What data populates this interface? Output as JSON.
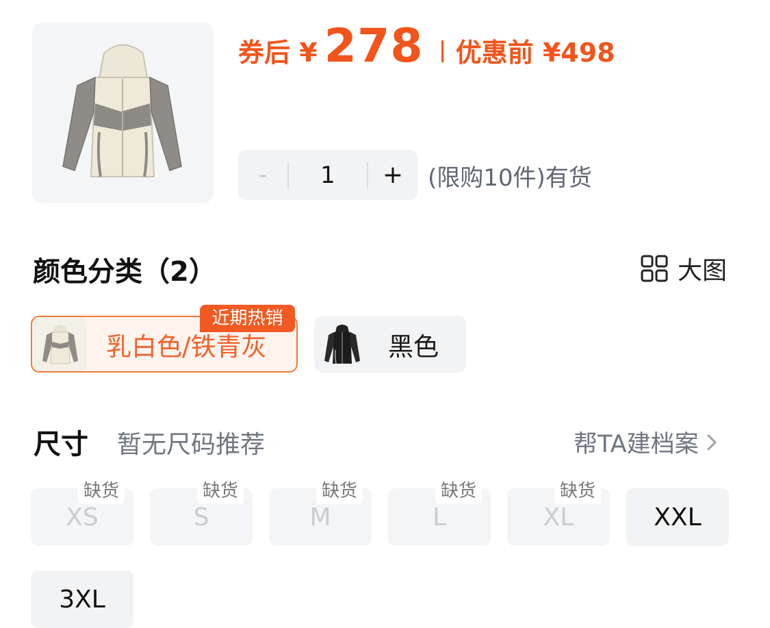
{
  "price": {
    "prefix": "券后 ¥",
    "value": "278",
    "original": "优惠前 ¥498"
  },
  "quantity": {
    "minus": "-",
    "value": "1",
    "plus": "+",
    "stock_note": "(限购10件)有货"
  },
  "color_section": {
    "title": "颜色分类（2）",
    "big_image_label": "大图",
    "hot_badge": "近期热销",
    "options": [
      {
        "label": "乳白色/铁青灰"
      },
      {
        "label": "黑色"
      }
    ]
  },
  "size_section": {
    "title": "尺寸",
    "tip": "暂无尺码推荐",
    "profile_link": "帮TA建档案",
    "out_of_stock_label": "缺货",
    "sizes": [
      {
        "label": "XS"
      },
      {
        "label": "S"
      },
      {
        "label": "M"
      },
      {
        "label": "L"
      },
      {
        "label": "XL"
      },
      {
        "label": "XXL"
      },
      {
        "label": "3XL"
      }
    ]
  },
  "colors": {
    "accent": "#f2541c",
    "selected_border": "#f27a3a",
    "muted_text": "#6f7680"
  }
}
